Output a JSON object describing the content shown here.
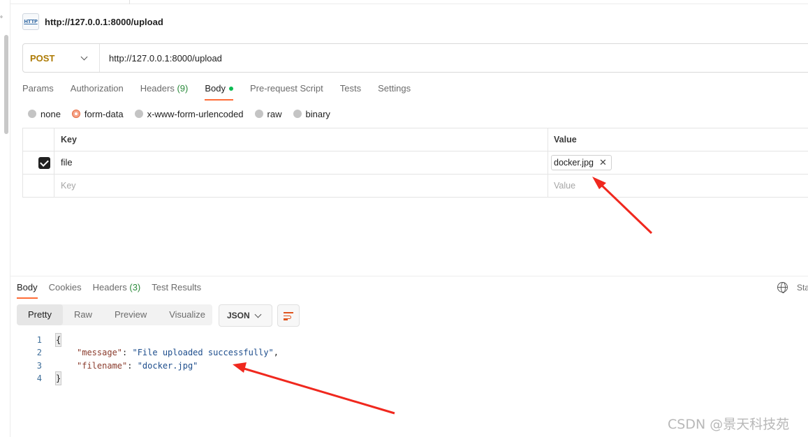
{
  "request": {
    "icon": "http-icon",
    "icon_text": "HTTP",
    "title": "http://127.0.0.1:8000/upload",
    "method": "POST",
    "url": "http://127.0.0.1:8000/upload"
  },
  "request_tabs": [
    {
      "label": "Params"
    },
    {
      "label": "Authorization"
    },
    {
      "label": "Headers",
      "count": "(9)"
    },
    {
      "label": "Body",
      "active": true,
      "indicator": "green-dot"
    },
    {
      "label": "Pre-request Script"
    },
    {
      "label": "Tests"
    },
    {
      "label": "Settings"
    }
  ],
  "body_types": [
    {
      "label": "none",
      "checked": false
    },
    {
      "label": "form-data",
      "checked": true
    },
    {
      "label": "x-www-form-urlencoded",
      "checked": false
    },
    {
      "label": "raw",
      "checked": false
    },
    {
      "label": "binary",
      "checked": false
    }
  ],
  "form_table": {
    "header_key": "Key",
    "header_value": "Value",
    "rows": [
      {
        "checked": true,
        "key": "file",
        "value": "docker.jpg",
        "value_type": "file"
      }
    ],
    "placeholder_key": "Key",
    "placeholder_value": "Value"
  },
  "response_tabs": [
    {
      "label": "Body",
      "active": true
    },
    {
      "label": "Cookies"
    },
    {
      "label": "Headers",
      "count": "(3)"
    },
    {
      "label": "Test Results"
    }
  ],
  "status_cutoff": "Sta",
  "view_modes": [
    {
      "label": "Pretty",
      "active": true
    },
    {
      "label": "Raw"
    },
    {
      "label": "Preview"
    },
    {
      "label": "Visualize"
    }
  ],
  "format": "JSON",
  "response_body": {
    "lines": [
      "1",
      "2",
      "3",
      "4"
    ],
    "open_brace": "{",
    "close_brace": "}",
    "message_key": "\"message\"",
    "message_value": "\"File uploaded successfully\"",
    "filename_key": "\"filename\"",
    "filename_value": "\"docker.jpg\"",
    "colon": ": ",
    "comma": ","
  },
  "watermark": "CSDN @景天科技苑",
  "colors": {
    "accent": "#ff6c37",
    "method_post": "#ad7a03",
    "annotation_arrow": "#f0281e",
    "count_green": "#2a8a3a"
  }
}
